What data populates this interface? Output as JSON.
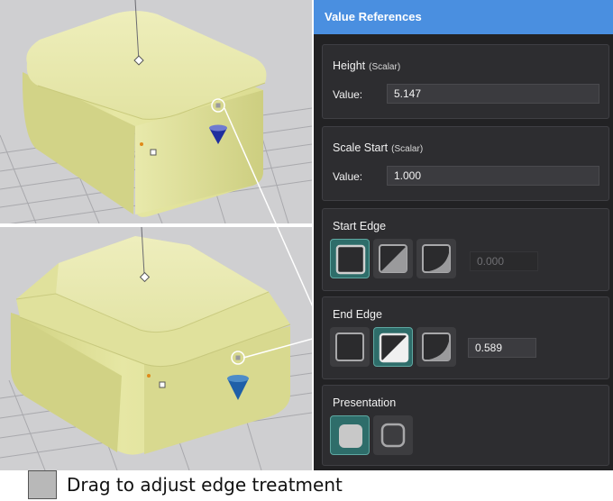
{
  "panel": {
    "title": "Value References",
    "height": {
      "label": "Height",
      "type": "(Scalar)",
      "value_label": "Value:",
      "value": "5.147"
    },
    "scale_start": {
      "label": "Scale Start",
      "type": "(Scalar)",
      "value_label": "Value:",
      "value": "1.000"
    },
    "start_edge": {
      "label": "Start Edge",
      "value": "0.000",
      "selected": "square"
    },
    "end_edge": {
      "label": "End Edge",
      "value": "0.589",
      "selected": "chamfer"
    },
    "presentation": {
      "label": "Presentation",
      "selected": "solid"
    }
  },
  "caption": {
    "text": "Drag to adjust edge treatment"
  },
  "colors": {
    "accent": "#4a8fe0",
    "selected": "#2e6d6a",
    "panel_bg": "#222224",
    "section_bg": "#2d2d30",
    "solid_fill": "#e6e7a0",
    "handle_cone": "#1f2f9e"
  },
  "icons": {
    "edge_options": [
      "square-edge-icon",
      "chamfer-edge-icon",
      "fillet-edge-icon"
    ],
    "presentation_options": [
      "solid-presentation-icon",
      "outline-presentation-icon"
    ],
    "caption": "gray-swatch-icon"
  }
}
